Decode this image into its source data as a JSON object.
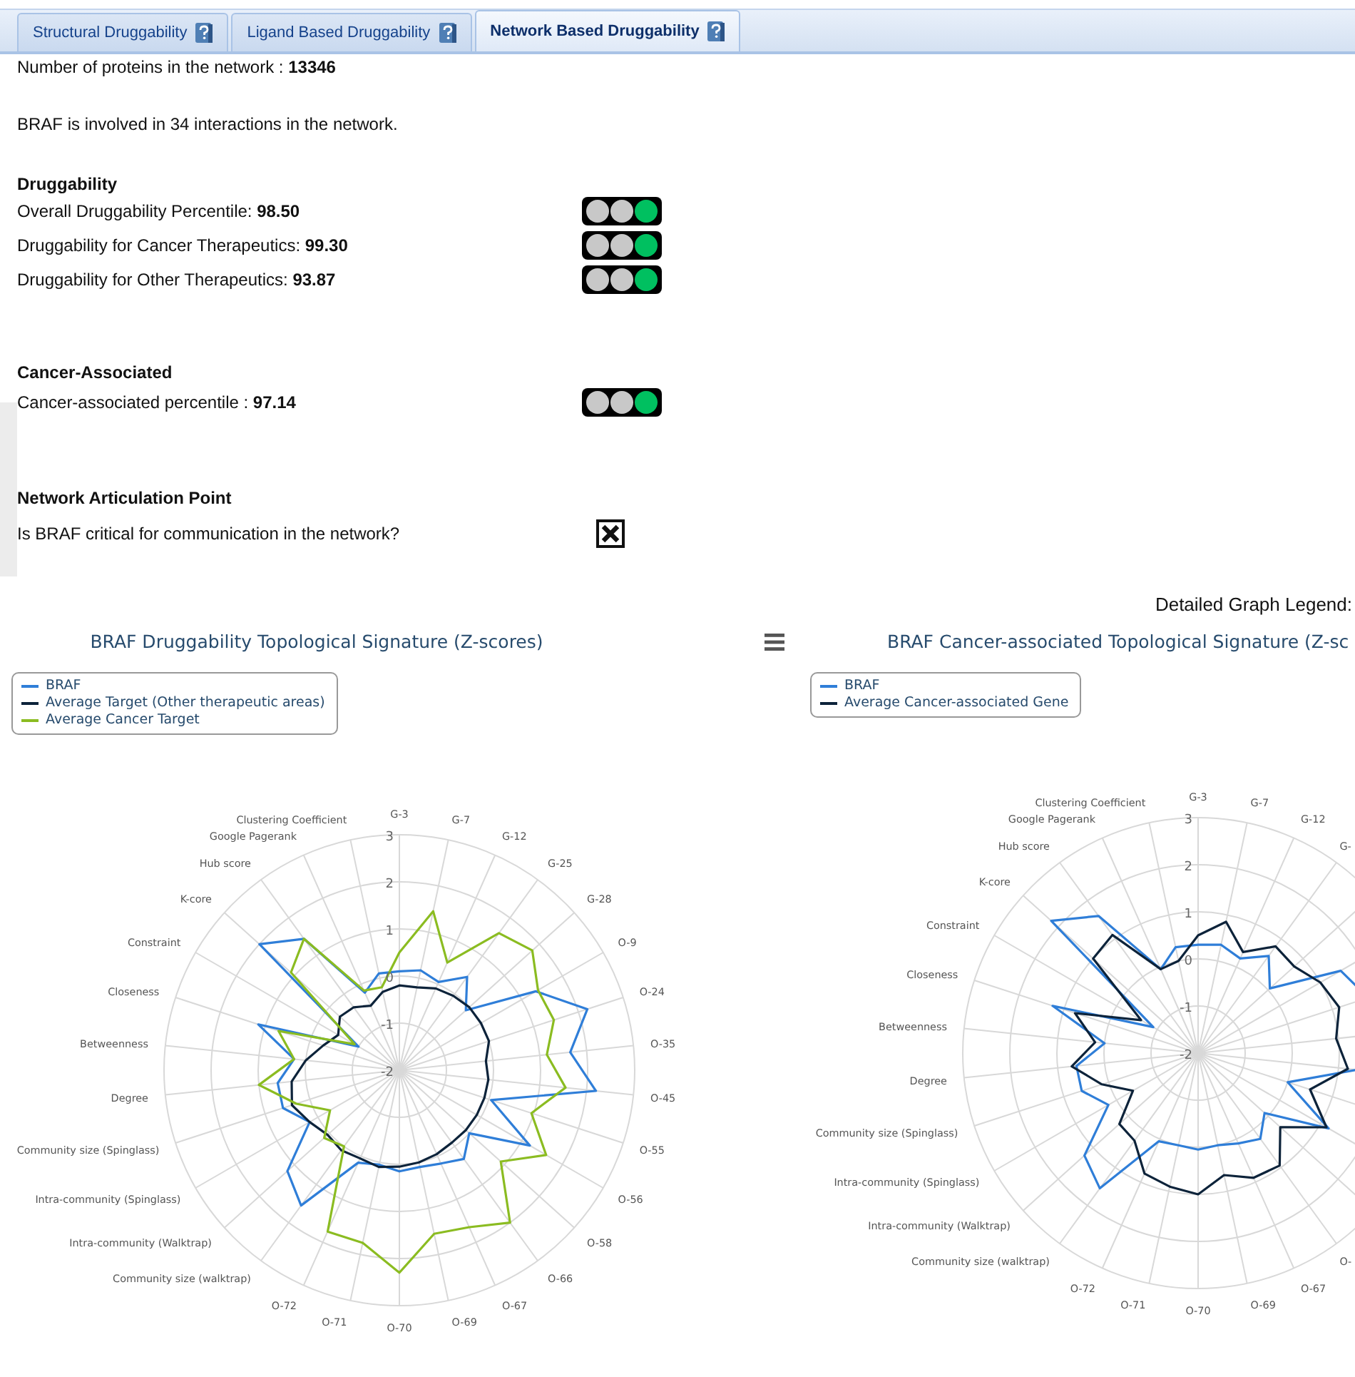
{
  "tabs": [
    {
      "label": "Structural Druggability",
      "selected": false
    },
    {
      "label": "Ligand Based Druggability",
      "selected": false
    },
    {
      "label": "Network Based Druggability",
      "selected": true
    }
  ],
  "network_summary": {
    "proteins_text": "Number of proteins in the network : **13346**",
    "interactions_text": "BRAF is involved in 34 interactions in the network."
  },
  "druggability": {
    "heading": "Druggability",
    "rows": [
      {
        "text": "Overall Druggability Percentile: **98.50**",
        "lamps": [
          {
            "on": false
          },
          {
            "on": false
          },
          {
            "on": true
          }
        ]
      },
      {
        "text": "Druggability for Cancer Therapeutics: **99.30**",
        "lamps": [
          {
            "on": false
          },
          {
            "on": false
          },
          {
            "on": true
          }
        ]
      },
      {
        "text": "Druggability for Other Therapeutics: **93.87**",
        "lamps": [
          {
            "on": false
          },
          {
            "on": false
          },
          {
            "on": true
          }
        ]
      }
    ]
  },
  "cancer_associated": {
    "heading": "Cancer-Associated",
    "rows": [
      {
        "text": "Cancer-associated percentile : **97.14**",
        "lamps": [
          {
            "on": false
          },
          {
            "on": false
          },
          {
            "on": true
          }
        ]
      }
    ]
  },
  "articulation_point": {
    "heading": "Network Articulation Point",
    "question": "Is BRAF critical for communication in the network?",
    "critical": false
  },
  "graph_legend_label": "Detailed Graph Legend:",
  "charts": [
    {
      "title": "BRAF Druggability Topological Signature (Z-scores)",
      "menu": true,
      "legend": [
        {
          "name": "BRAF",
          "color": "#2f7ed8"
        },
        {
          "name": "Average Target (Other therapeutic areas)",
          "color": "#0d233a"
        },
        {
          "name": "Average Cancer Target",
          "color": "#8bbc21"
        }
      ],
      "axis_labels": [
        "G-3",
        "G-7",
        "G-12",
        "G-25",
        "G-28",
        "O-9",
        "O-24",
        "O-35",
        "O-45",
        "O-55",
        "O-56",
        "O-58",
        "O-66",
        "O-67",
        "O-69",
        "O-70",
        "Clustering Coefficient",
        "Google Pagerank",
        "Hub score",
        "K-core",
        "Constraint",
        "Closeness",
        "Betweenness",
        "Degree",
        "Community size (Spinglass)",
        "Intra-community (Spinglass)",
        "Intra-community (Walktrap)",
        "Community size (walktrap)",
        "O-72",
        "O-71"
      ],
      "tick_labels": [
        "3",
        "2",
        "1",
        "0",
        "-1",
        "-2"
      ]
    },
    {
      "title": "BRAF Cancer-associated Topological Signature (Z-sc",
      "legend": [
        {
          "name": "BRAF",
          "color": "#2f7ed8"
        },
        {
          "name": "Average Cancer-associated Gene",
          "color": "#0d233a"
        }
      ],
      "axis_labels": [
        "G-3",
        "G-7",
        "G-12",
        "G-",
        "O-",
        "O-67",
        "O-69",
        "O-70",
        "Clustering Coefficient",
        "Google Pagerank",
        "Hub score",
        "K-core",
        "Constraint",
        "Closeness",
        "Betweenness",
        "Degree",
        "Community size (Spinglass)",
        "Intra-community (Spinglass)",
        "Intra-community (Walktrap)",
        "Community size (walktrap)",
        "O-72",
        "O-71"
      ],
      "tick_labels": [
        "3",
        "2",
        "1",
        "0",
        "-1",
        "-2"
      ]
    }
  ]
}
